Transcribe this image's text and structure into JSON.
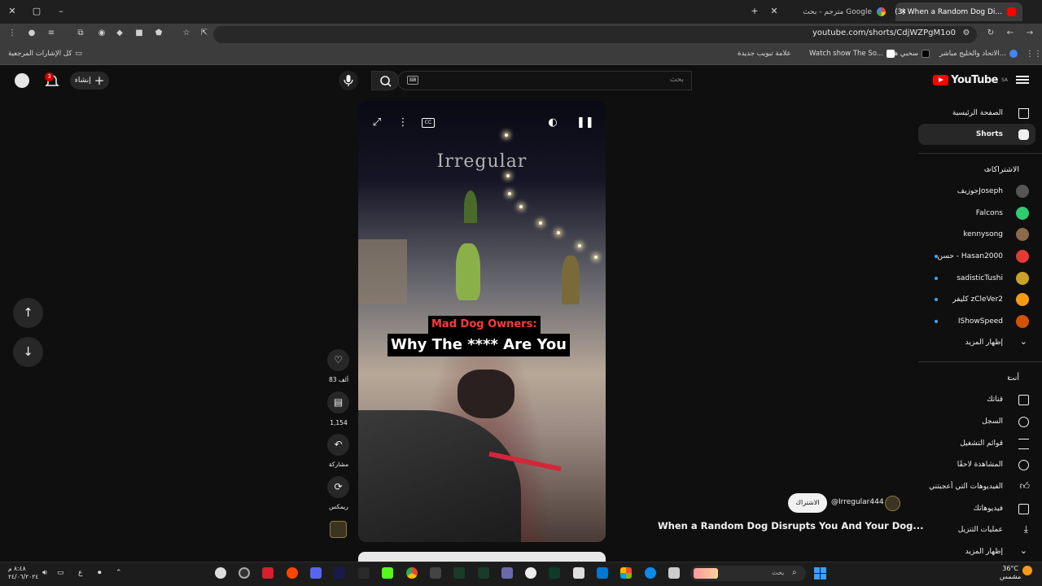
{
  "tabs": [
    {
      "title": "(3) When a Random Dog Di...",
      "active": true
    },
    {
      "title": "مترجم - بحث Google",
      "active": false
    }
  ],
  "address": {
    "url": "youtube.com/shorts/CdjWZPgM1o0"
  },
  "bookmarks": {
    "all_bookmarks": "كل الإشارات المرجعية",
    "items": [
      "الاتحاد والخليج مباشر...",
      "سحبي ها",
      "Watch show The So...",
      "علامة تبويب جديدة"
    ]
  },
  "header": {
    "logo_text": "YouTube",
    "region": "SA",
    "search_placeholder": "بحث",
    "create_label": "إنشاء",
    "notification_count": "3"
  },
  "sidebar": {
    "main": [
      {
        "label": "الصفحة الرئيسية",
        "icon": "home-icon"
      },
      {
        "label": "Shorts",
        "icon": "shorts-icon",
        "active": true
      }
    ],
    "subscriptions_heading": "الاشتراكات",
    "channels": [
      {
        "label": "جوزيفJoseph",
        "color": "#555555",
        "live": false
      },
      {
        "label": "Falcons",
        "color": "#2ecc71",
        "live": false
      },
      {
        "label": "kennysong",
        "color": "#8a6a4a",
        "live": false
      },
      {
        "label": "حسن - Hasan2000",
        "color": "#e53935",
        "live": true
      },
      {
        "label": "sadisticTushi",
        "color": "#c9a227",
        "live": true
      },
      {
        "label": "كليفر zCleVer2",
        "color": "#f39c12",
        "live": true
      },
      {
        "label": "IShowSpeed",
        "color": "#d35400",
        "live": true
      }
    ],
    "show_more": "إظهار المزيد",
    "you_heading": "أنت",
    "you_items": [
      {
        "label": "قناتك",
        "icon": "your-channel-icon"
      },
      {
        "label": "السجل",
        "icon": "history-icon"
      },
      {
        "label": "قوائم التشغيل",
        "icon": "playlists-icon"
      },
      {
        "label": "المشاهدة لاحقًا",
        "icon": "watch-later-icon"
      },
      {
        "label": "الفيديوهات التي أعجبتني",
        "icon": "liked-icon"
      },
      {
        "label": "فيديوهاتك",
        "icon": "your-videos-icon"
      },
      {
        "label": "عمليات التنزيل",
        "icon": "downloads-icon"
      }
    ],
    "show_more_2": "إظهار المزيد"
  },
  "player": {
    "watermark": "Irregular",
    "caption_line1": "Mad Dog Owners:",
    "caption_line2": "Why The **** Are You"
  },
  "actions": {
    "likes": "83 ألف",
    "comments": "1,154",
    "share": "مشاركة",
    "remix": "ريمكس"
  },
  "video": {
    "channel_handle": "@Irregular444",
    "subscribe_label": "الاشتراك",
    "title": "When a Random Dog Disrupts You And Your Dog..."
  },
  "taskbar": {
    "search_label": "بحث",
    "weather_temp": "36°C",
    "weather_desc": "مشمس",
    "clock_time": "٨:٤٨ م",
    "clock_date": "٢٤/٠٦/٢٠٢٤",
    "lang": "ع"
  }
}
